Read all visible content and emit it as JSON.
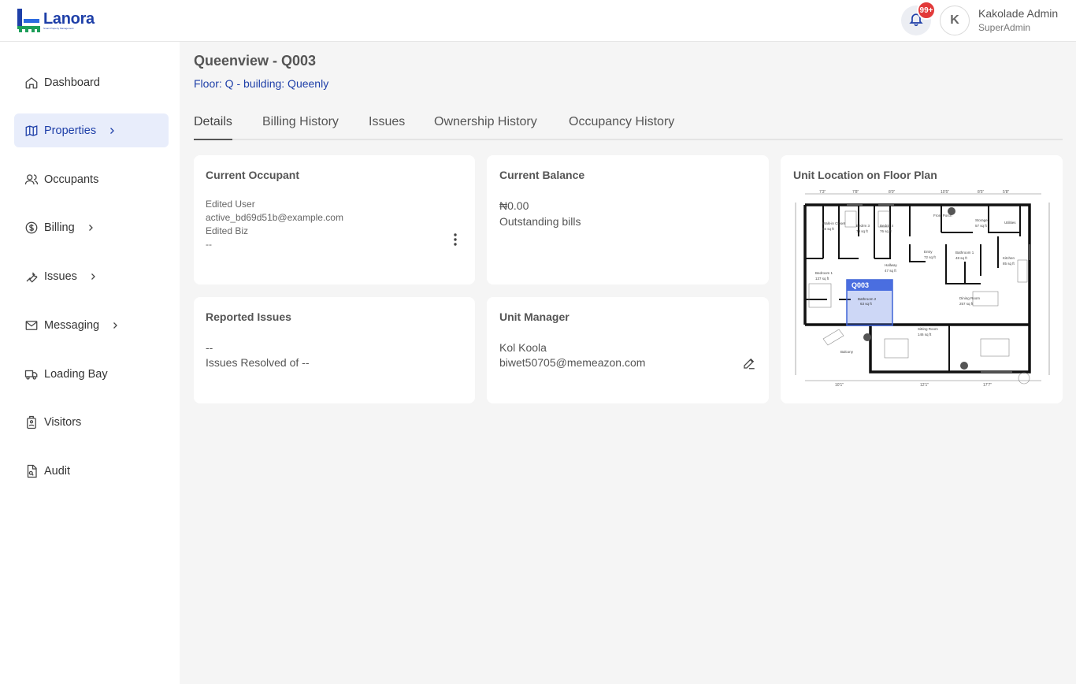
{
  "brand": {
    "name": "Lanora",
    "tagline": "Smart Property Management"
  },
  "header": {
    "notification_count": "99+",
    "avatar_initial": "K",
    "user_name": "Kakolade Admin",
    "user_role": "SuperAdmin"
  },
  "sidebar": {
    "items": [
      {
        "label": "Dashboard",
        "icon": "home-icon"
      },
      {
        "label": "Properties",
        "icon": "map-icon"
      },
      {
        "label": "Occupants",
        "icon": "users-icon"
      },
      {
        "label": "Billing",
        "icon": "dollar-icon"
      },
      {
        "label": "Issues",
        "icon": "wrench-icon"
      },
      {
        "label": "Messaging",
        "icon": "mail-icon"
      },
      {
        "label": "Loading Bay",
        "icon": "truck-icon"
      },
      {
        "label": "Visitors",
        "icon": "badge-icon"
      },
      {
        "label": "Audit",
        "icon": "document-icon"
      }
    ]
  },
  "page": {
    "title": "Queenview - Q003",
    "subtitle": "Floor: Q - building: Queenly"
  },
  "tabs": [
    "Details",
    "Billing History",
    "Issues",
    "Ownership History",
    "Occupancy History"
  ],
  "occupant": {
    "title": "Current Occupant",
    "name": "Edited User",
    "email": "active_bd69d51b@example.com",
    "business": "Edited Biz",
    "extra": "--"
  },
  "balance": {
    "title": "Current Balance",
    "amount": "₦0.00",
    "caption": "Outstanding bills"
  },
  "floorplan": {
    "title": "Unit Location on Floor Plan",
    "unit_label": "Q003",
    "rooms": [
      "Walk-in Closet",
      "Bedrm 3",
      "Bedrm 4",
      "Front Porch",
      "Storage",
      "Utilities",
      "Entry",
      "Bathroom 1",
      "Kitchen",
      "Hallway",
      "Bedroom 1",
      "Bathroom 2",
      "Dining Room",
      "Sitting Room",
      "Balcony"
    ],
    "room_areas": [
      "66 sq ft",
      "70 sq ft",
      "76 sq ft",
      "57 sq ft",
      "72 sq ft",
      "48 sq ft",
      "85 sq ft",
      "47 sq ft",
      "137 sq ft",
      "63 sq ft",
      "257 sq ft",
      "146 sq ft"
    ],
    "dimensions": [
      "7'3\"",
      "7'8\"",
      "8'0\"",
      "10'5\"",
      "8'5\"",
      "5'8\"",
      "10'1\"",
      "12'1\"",
      "17'7\""
    ]
  },
  "issues": {
    "title": "Reported Issues",
    "count": "--",
    "resolved": "Issues Resolved of --"
  },
  "manager": {
    "title": "Unit Manager",
    "name": "Kol Koola",
    "email": "biwet50705@memeazon.com"
  },
  "colors": {
    "brand": "#1e3fa8",
    "active_bg": "#e8edfb",
    "badge": "#e23a3a",
    "highlight": "#4a6ee0"
  }
}
